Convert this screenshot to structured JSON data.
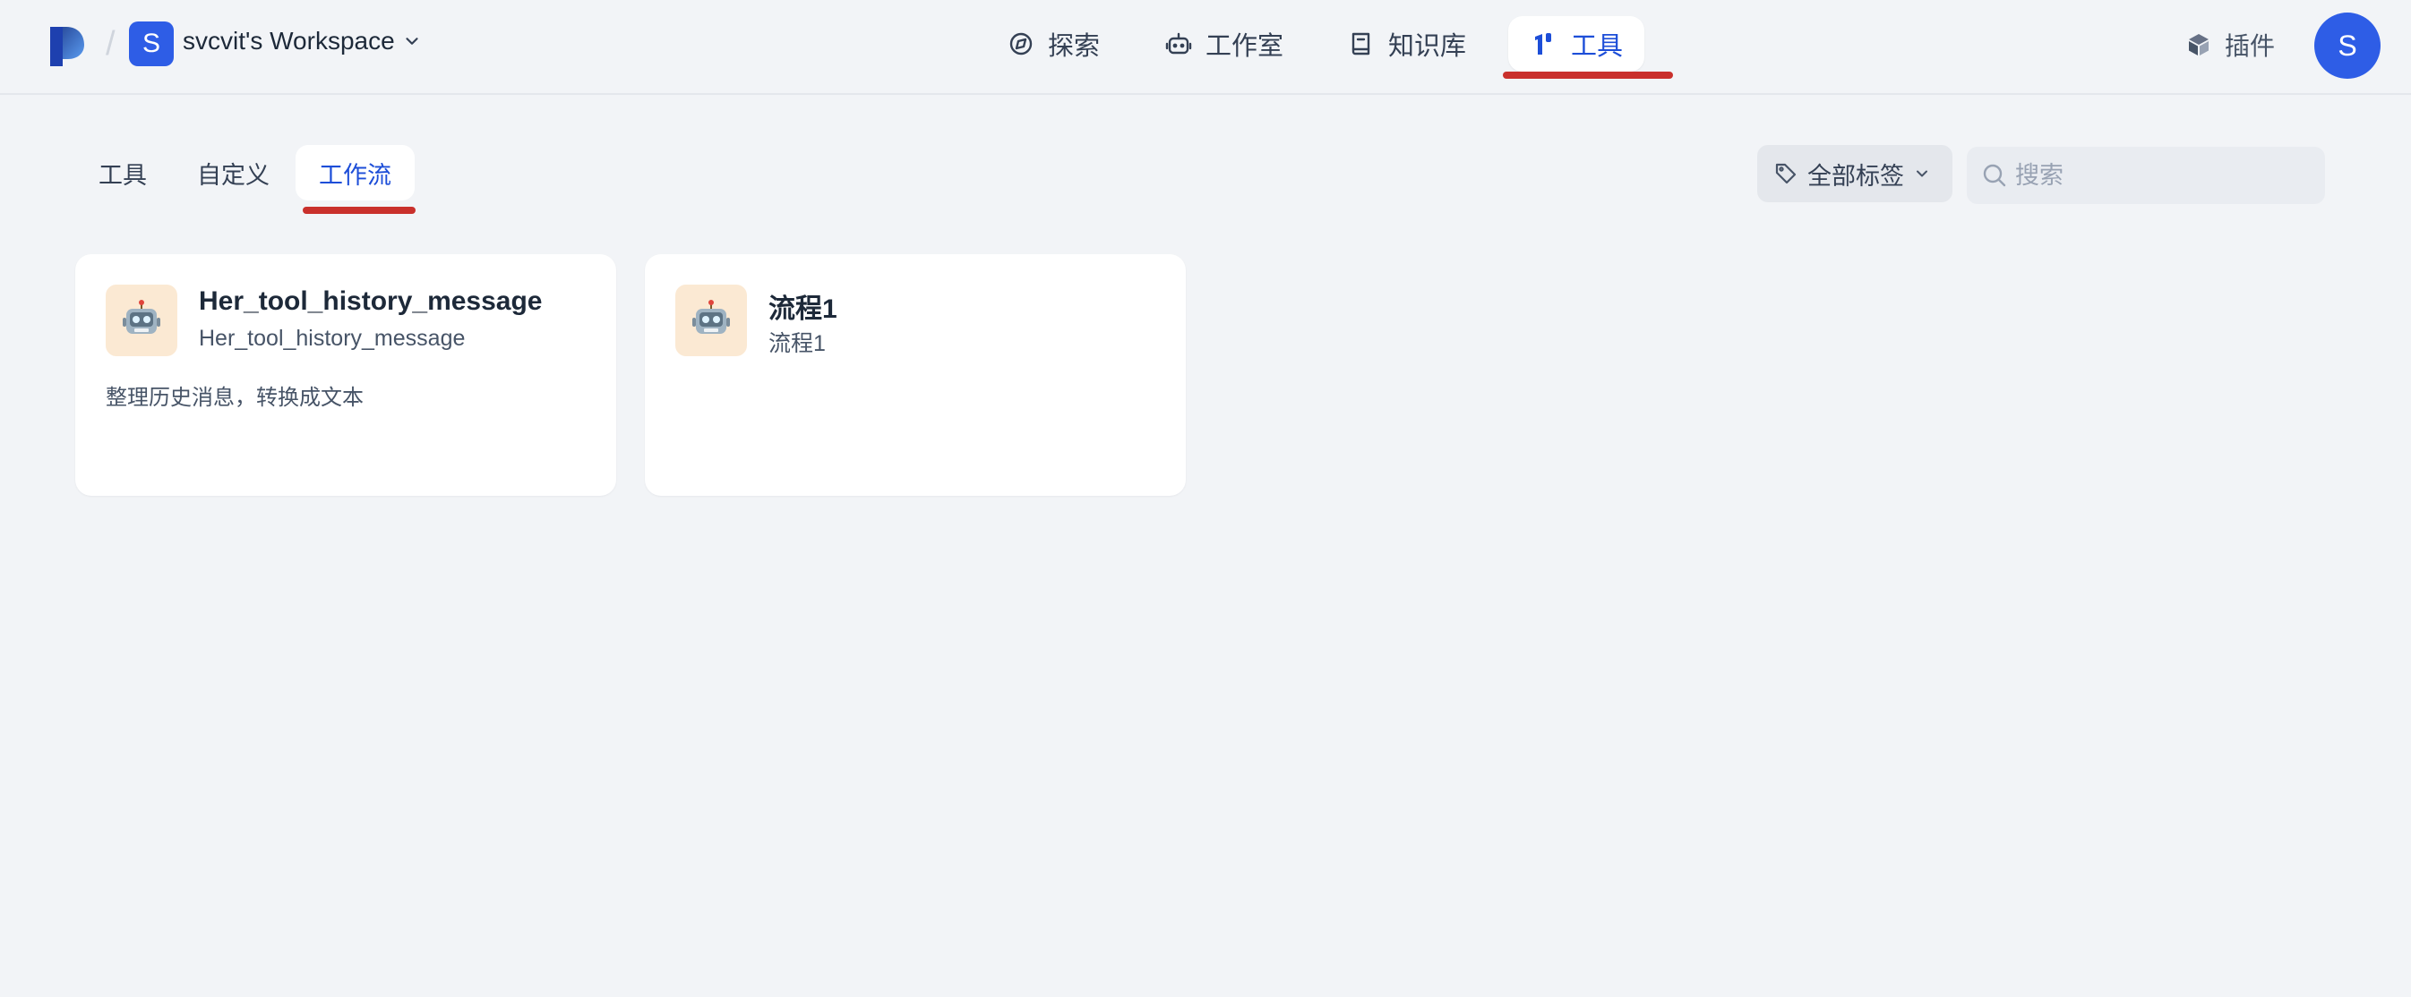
{
  "header": {
    "workspace_initial": "S",
    "workspace_name": "svcvit's Workspace",
    "nav": [
      {
        "label": "探索",
        "icon": "compass-icon"
      },
      {
        "label": "工作室",
        "icon": "robot-icon"
      },
      {
        "label": "知识库",
        "icon": "book-icon"
      },
      {
        "label": "工具",
        "icon": "tools-icon",
        "active": true
      }
    ],
    "plugins_label": "插件",
    "avatar_initial": "S"
  },
  "subtabs": [
    {
      "label": "工具"
    },
    {
      "label": "自定义"
    },
    {
      "label": "工作流",
      "active": true
    }
  ],
  "filters": {
    "tag_label": "全部标签",
    "search_placeholder": "搜索"
  },
  "cards": [
    {
      "title": "Her_tool_history_message",
      "subtitle": "Her_tool_history_message",
      "description": "整理历史消息，转换成文本",
      "icon": "robot-emoji-icon"
    },
    {
      "title": "流程1",
      "subtitle": "流程1",
      "description": "",
      "icon": "robot-emoji-icon"
    }
  ],
  "colors": {
    "accent": "#1d4ed8",
    "brand_badge": "#2e5de6",
    "underline": "#c9302c",
    "background": "#f2f4f7"
  }
}
